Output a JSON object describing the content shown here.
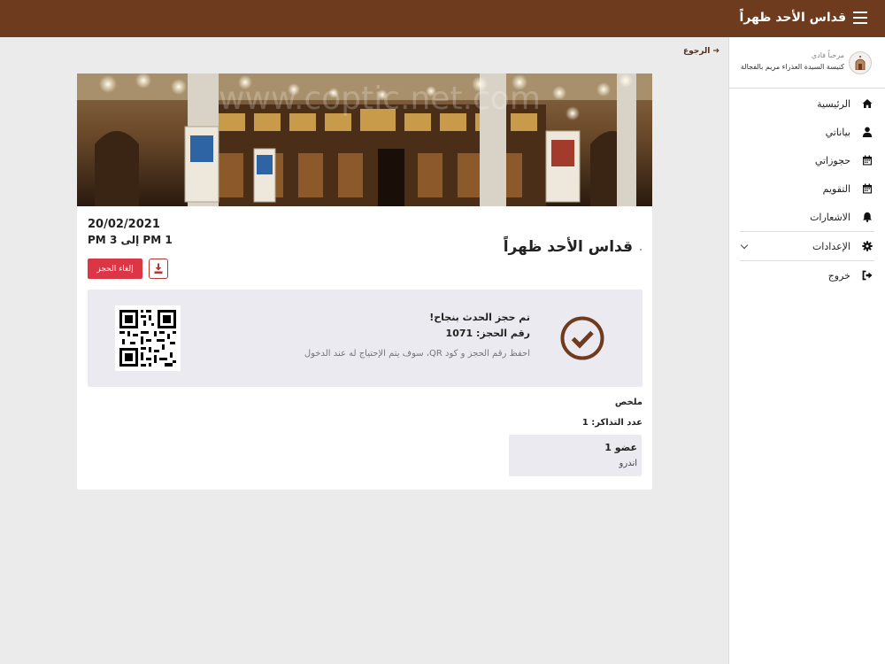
{
  "header": {
    "title": "قداس الأحد ظهراً",
    "menu_icon": "hamburger-menu-icon",
    "background": "#6e3b1f"
  },
  "sidebar": {
    "greeting": "مرحباً فادي",
    "church": "كنيسة السيدة العذراء مريم بالفجالة",
    "items": [
      {
        "label": "الرئيسية",
        "icon": "home-icon"
      },
      {
        "label": "بياناتي",
        "icon": "user-icon"
      },
      {
        "label": "حجوزاتي",
        "icon": "calendar-icon"
      },
      {
        "label": "التقويم",
        "icon": "calendar-icon"
      },
      {
        "label": "الاشعارات",
        "icon": "bell-icon"
      },
      {
        "label": "الإعدادات",
        "icon": "gear-icon"
      },
      {
        "label": "خروج",
        "icon": "sign-out-icon"
      }
    ]
  },
  "main": {
    "back_label": "الرجوع",
    "event": {
      "title": "قداس الأحد ظهراً",
      "date": "20/02/2021",
      "time": "1 PM إلى 3 PM",
      "cancel_label": "إلغاء الحجز",
      "download_icon": "download-icon"
    },
    "confirmation": {
      "line1": "تم حجز الحدث بنجاح!",
      "line2": "رقم الحجز: 1071",
      "line3": "احفظ رقم الحجز و كود QR، سوف يتم الإحتياج له عند الدخول",
      "icon": "check-circle-icon",
      "accent": "#6e3b1f"
    },
    "summary": {
      "title": "ملخص",
      "tickets": "عدد التذاكر: 1",
      "member_name": "عضو 1",
      "member_value": "اندرو"
    },
    "banner_watermark": "www.coptic.net.com"
  }
}
